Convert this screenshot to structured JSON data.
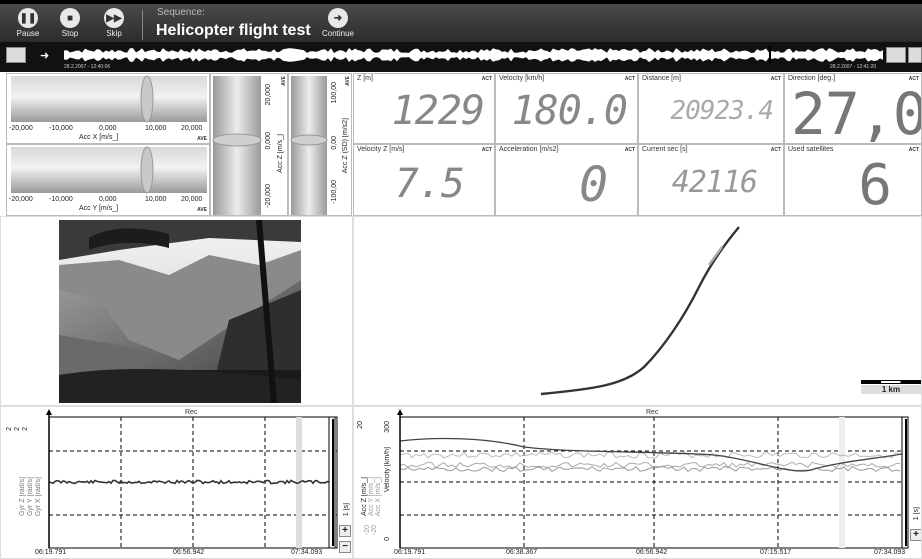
{
  "toolbar": {
    "pause_label": "Pause",
    "stop_label": "Stop",
    "skip_label": "Skip",
    "continue_label": "Continue",
    "sequence_label": "Sequence:",
    "sequence_title": "Helicopter flight test"
  },
  "overview": {
    "start_time": "28.2.2007 - 12:40:06",
    "end_time": "28.2.2007 - 12:41:20"
  },
  "accel_panels": {
    "acc_x": {
      "label": "Acc X [m/s_]",
      "ticks": [
        "-20,000",
        "-10,000",
        "0,000",
        "10,000",
        "20,000"
      ],
      "ave": "AVE"
    },
    "acc_y": {
      "label": "Acc Y [m/s_]",
      "ticks": [
        "-20,000",
        "-10,000",
        "0,000",
        "10,000",
        "20,000"
      ],
      "ave": "AVE"
    },
    "acc_z": {
      "label": "Acc Z [m/s_]",
      "ticks": [
        "20,000",
        "0,000",
        "-20,000"
      ],
      "ave": "AVE"
    },
    "acc_z_sd": {
      "label": "Acc Z (SD) [m/s2]",
      "ticks": [
        "100,00",
        "0,00",
        "-100,00"
      ],
      "ave": "AVE"
    }
  },
  "displays": [
    {
      "caption": "Z [m]",
      "act": "ACT",
      "value": "1229"
    },
    {
      "caption": "Velocity [km/h]",
      "act": "ACT",
      "value": "180.0"
    },
    {
      "caption": "Distance [m]",
      "act": "ACT",
      "value": "20923.4"
    },
    {
      "caption": "Direction [deg.]",
      "act": "ACT",
      "value": "27,0"
    },
    {
      "caption": "Velocity Z [m/s]",
      "act": "ACT",
      "value": "7.5"
    },
    {
      "caption": "Acceleration [m/s2]",
      "act": "ACT",
      "value": "0"
    },
    {
      "caption": "Current sec [s]",
      "act": "ACT",
      "value": "42116"
    },
    {
      "caption": "Used satellites",
      "act": "ACT",
      "value": "6"
    }
  ],
  "map": {
    "scale_label": "1 km"
  },
  "chart_left": {
    "title": "Rec",
    "series_labels": [
      "Gyr Z [rad/s]",
      "Gyr Y [rad/s]",
      "Gyr X [rad/s]"
    ],
    "y_ticks": [
      "2",
      "2",
      "2"
    ],
    "x_ticks": [
      "06:19.791",
      "06:56.942",
      "07:34.093"
    ],
    "zoom_label": "1 [s]"
  },
  "chart_right": {
    "title": "Rec",
    "series_labels": [
      "Acc Z [m/s_]",
      "Acc Y [m/s_]",
      "Acc X [m/s_]",
      "Velocity [km/h]"
    ],
    "y_ticks_left": [
      "20",
      "-20",
      "-20"
    ],
    "y_ticks_right": [
      "300",
      "0"
    ],
    "x_ticks": [
      "06:19.791",
      "06:38.367",
      "06:56.942",
      "07:15.517",
      "07:34.093"
    ],
    "zoom_label": "1 [s]"
  }
}
